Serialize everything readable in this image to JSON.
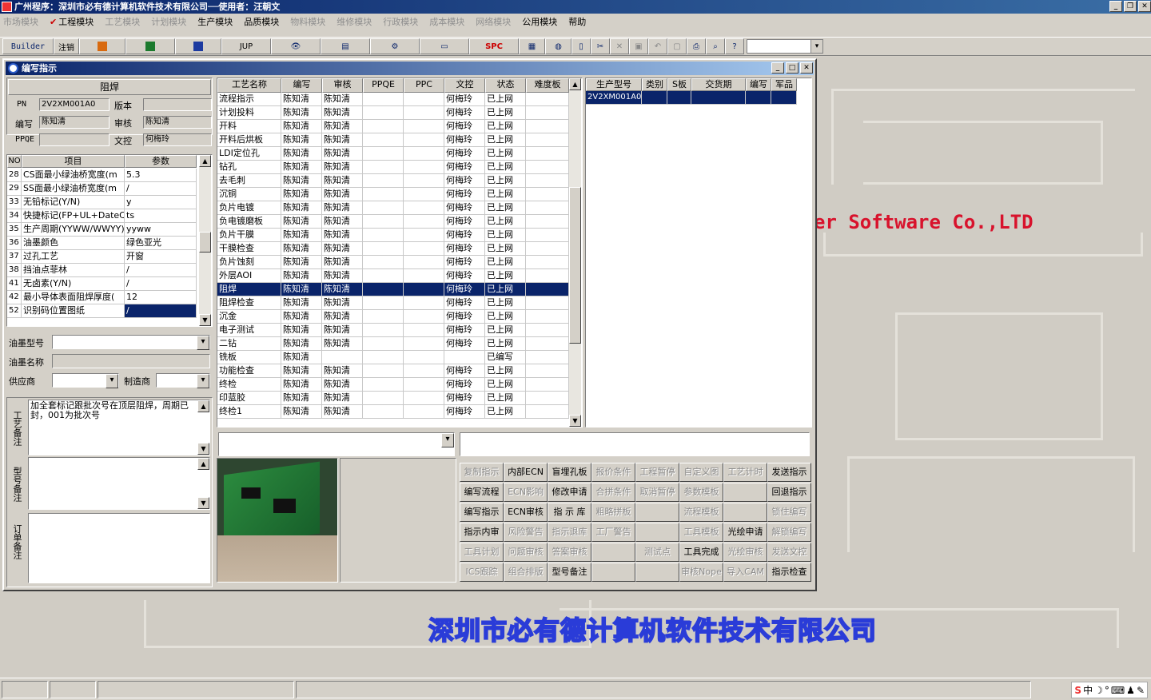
{
  "titlebar": {
    "title": "广州程序：深圳市必有德计算机软件技术有限公司──使用者：汪朝文"
  },
  "menu": {
    "items": [
      {
        "label": "市场模块",
        "disabled": true
      },
      {
        "label": "工程模块",
        "disabled": false,
        "checked": true
      },
      {
        "label": "工艺模块",
        "disabled": true
      },
      {
        "label": "计划模块",
        "disabled": true
      },
      {
        "label": "生产模块",
        "disabled": false
      },
      {
        "label": "品质模块",
        "disabled": false
      },
      {
        "label": "物料模块",
        "disabled": true
      },
      {
        "label": "维修模块",
        "disabled": true
      },
      {
        "label": "行政模块",
        "disabled": true
      },
      {
        "label": "成本模块",
        "disabled": true
      },
      {
        "label": "网络模块",
        "disabled": true
      },
      {
        "label": "公用模块",
        "disabled": false
      },
      {
        "label": "帮助",
        "disabled": false
      }
    ]
  },
  "toolbar": {
    "builder": "Builder",
    "logout": "注销",
    "jup": "JUP",
    "spc": "SPC"
  },
  "brand": {
    "english": "er Software Co.,LTD",
    "chinese": "深圳市必有德计算机软件技术有限公司"
  },
  "window": {
    "title": "编写指示",
    "section_title": "阻焊",
    "labels": {
      "pn": "PN",
      "version": "版本",
      "editor": "编写",
      "reviewer": "审核",
      "ppqe": "PPQE",
      "doc": "文控"
    },
    "values": {
      "pn": "2V2XM001A0",
      "version": "",
      "editor": "陈知清",
      "reviewer": "陈知清",
      "ppqe": "",
      "doc": "何梅玲"
    },
    "param_headers": [
      "NO",
      "项目",
      "参数"
    ],
    "params": [
      [
        "28",
        "CS面最小绿油桥宽度(m",
        "5.3"
      ],
      [
        "29",
        "SS面最小绿油桥宽度(m",
        "/"
      ],
      [
        "33",
        "无铅标记(Y/N)",
        "y"
      ],
      [
        "34",
        "快捷标记(FP+UL+DateCo",
        "ts"
      ],
      [
        "35",
        "生产周期(YYWW/WWYY)",
        "yyww"
      ],
      [
        "36",
        "油墨颜色",
        "绿色亚光"
      ],
      [
        "37",
        "过孔工艺",
        "开窗"
      ],
      [
        "38",
        "挡油点菲林",
        "/"
      ],
      [
        "41",
        "无卤素(Y/N)",
        "/"
      ],
      [
        "42",
        "最小导体表面阻焊厚度(",
        "12"
      ],
      [
        "52",
        "识别码位置图纸",
        "/"
      ]
    ],
    "ink_model_label": "油墨型号",
    "ink_name_label": "油墨名称",
    "supplier_label": "供应商",
    "maker_label": "制造商",
    "process_note_label": "工艺备注",
    "model_note_label": "型号备注",
    "order_note_label": "订单备注",
    "process_note": "加全套标记跟批次号在顶层阻焊，周期已封，001为批次号",
    "process_headers": [
      "工艺名称",
      "编写",
      "审核",
      "PPQE",
      "PPC",
      "文控",
      "状态",
      "难度板"
    ],
    "processes": [
      [
        "流程指示",
        "陈知清",
        "陈知清",
        "",
        "",
        "何梅玲",
        "已上网",
        ""
      ],
      [
        "计划投料",
        "陈知清",
        "陈知清",
        "",
        "",
        "何梅玲",
        "已上网",
        ""
      ],
      [
        "开料",
        "陈知清",
        "陈知清",
        "",
        "",
        "何梅玲",
        "已上网",
        ""
      ],
      [
        "开料后烘板",
        "陈知清",
        "陈知清",
        "",
        "",
        "何梅玲",
        "已上网",
        ""
      ],
      [
        "LDI定位孔",
        "陈知清",
        "陈知清",
        "",
        "",
        "何梅玲",
        "已上网",
        ""
      ],
      [
        "钻孔",
        "陈知清",
        "陈知清",
        "",
        "",
        "何梅玲",
        "已上网",
        ""
      ],
      [
        "去毛刺",
        "陈知清",
        "陈知清",
        "",
        "",
        "何梅玲",
        "已上网",
        ""
      ],
      [
        "沉铜",
        "陈知清",
        "陈知清",
        "",
        "",
        "何梅玲",
        "已上网",
        ""
      ],
      [
        "负片电镀",
        "陈知清",
        "陈知清",
        "",
        "",
        "何梅玲",
        "已上网",
        ""
      ],
      [
        "负电镀磨板",
        "陈知清",
        "陈知清",
        "",
        "",
        "何梅玲",
        "已上网",
        ""
      ],
      [
        "负片干膜",
        "陈知清",
        "陈知清",
        "",
        "",
        "何梅玲",
        "已上网",
        ""
      ],
      [
        "干膜检查",
        "陈知清",
        "陈知清",
        "",
        "",
        "何梅玲",
        "已上网",
        ""
      ],
      [
        "负片蚀刻",
        "陈知清",
        "陈知清",
        "",
        "",
        "何梅玲",
        "已上网",
        ""
      ],
      [
        "外层AOI",
        "陈知清",
        "陈知清",
        "",
        "",
        "何梅玲",
        "已上网",
        ""
      ],
      [
        "阻焊",
        "陈知清",
        "陈知清",
        "",
        "",
        "何梅玲",
        "已上网",
        ""
      ],
      [
        "阻焊检查",
        "陈知清",
        "陈知清",
        "",
        "",
        "何梅玲",
        "已上网",
        ""
      ],
      [
        "沉金",
        "陈知清",
        "陈知清",
        "",
        "",
        "何梅玲",
        "已上网",
        ""
      ],
      [
        "电子测试",
        "陈知清",
        "陈知清",
        "",
        "",
        "何梅玲",
        "已上网",
        ""
      ],
      [
        "二钻",
        "陈知清",
        "陈知清",
        "",
        "",
        "何梅玲",
        "已上网",
        ""
      ],
      [
        "铣板",
        "陈知清",
        "",
        "",
        "",
        "",
        "已编写",
        ""
      ],
      [
        "功能检查",
        "陈知清",
        "陈知清",
        "",
        "",
        "何梅玲",
        "已上网",
        ""
      ],
      [
        "终检",
        "陈知清",
        "陈知清",
        "",
        "",
        "何梅玲",
        "已上网",
        ""
      ],
      [
        "印蓝胶",
        "陈知清",
        "陈知清",
        "",
        "",
        "何梅玲",
        "已上网",
        ""
      ],
      [
        "终检1",
        "陈知清",
        "陈知清",
        "",
        "",
        "何梅玲",
        "已上网",
        ""
      ]
    ],
    "selected_process": 14,
    "product_headers": [
      "生产型号",
      "类别",
      "S板",
      "交货期",
      "编写",
      "军品"
    ],
    "products": [
      [
        "2V2XM001A0",
        "",
        "",
        "",
        "",
        ""
      ]
    ],
    "buttons": [
      [
        {
          "l": "复制指示",
          "d": true
        },
        {
          "l": "内部ECN",
          "d": false
        },
        {
          "l": "盲埋孔板",
          "d": false
        },
        {
          "l": "报价条件",
          "d": true
        },
        {
          "l": "工程暂停",
          "d": true
        },
        {
          "l": "自定义图",
          "d": true
        },
        {
          "l": "工艺计时",
          "d": true
        },
        {
          "l": "发送指示",
          "d": false
        }
      ],
      [
        {
          "l": "编写流程",
          "d": false
        },
        {
          "l": "ECN影响",
          "d": true
        },
        {
          "l": "修改申请",
          "d": false
        },
        {
          "l": "合拼条件",
          "d": true
        },
        {
          "l": "取消暂停",
          "d": true
        },
        {
          "l": "参数模板",
          "d": true
        },
        {
          "l": "",
          "d": true
        },
        {
          "l": "回退指示",
          "d": false
        }
      ],
      [
        {
          "l": "编写指示",
          "d": false
        },
        {
          "l": "ECN审核",
          "d": false
        },
        {
          "l": "指 示 库",
          "d": false
        },
        {
          "l": "粗略拼板",
          "d": true
        },
        {
          "l": "",
          "d": true
        },
        {
          "l": "流程模板",
          "d": true
        },
        {
          "l": "",
          "d": true
        },
        {
          "l": "锁住编写",
          "d": true
        }
      ],
      [
        {
          "l": "指示内审",
          "d": false
        },
        {
          "l": "风险警告",
          "d": true
        },
        {
          "l": "指示退库",
          "d": true
        },
        {
          "l": "工厂警告",
          "d": true
        },
        {
          "l": "",
          "d": true
        },
        {
          "l": "工具模板",
          "d": true
        },
        {
          "l": "光绘申请",
          "d": false
        },
        {
          "l": "解锁编写",
          "d": true
        }
      ],
      [
        {
          "l": "工具计划",
          "d": true
        },
        {
          "l": "问题审核",
          "d": true
        },
        {
          "l": "答案审核",
          "d": true
        },
        {
          "l": "",
          "d": true
        },
        {
          "l": "测试点",
          "d": true
        },
        {
          "l": "工具完成",
          "d": false
        },
        {
          "l": "光绘审核",
          "d": true
        },
        {
          "l": "发送文控",
          "d": true
        }
      ],
      [
        {
          "l": "ICS跟踪",
          "d": true
        },
        {
          "l": "组合排版",
          "d": true
        },
        {
          "l": "型号备注",
          "d": false
        },
        {
          "l": "",
          "d": true
        },
        {
          "l": "",
          "d": true
        },
        {
          "l": "审核Nope",
          "d": true
        },
        {
          "l": "导入CAM",
          "d": true
        },
        {
          "l": "指示检查",
          "d": false
        }
      ]
    ]
  }
}
